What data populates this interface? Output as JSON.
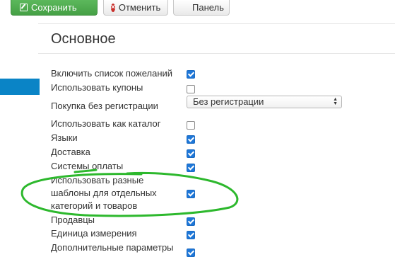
{
  "toolbar": {
    "save_label": "Сохранить",
    "cancel_label": "Отменить",
    "panel_label": "Панель"
  },
  "section": {
    "title": "Основное"
  },
  "settings": [
    {
      "label": "Включить список пожеланий",
      "checked": true
    },
    {
      "label": "Использовать купоны",
      "checked": false
    },
    {
      "label": "Покупка без регистрации",
      "type": "select",
      "value": "Без регистрации"
    },
    {
      "label": "Использовать как каталог",
      "checked": false
    },
    {
      "label": "Языки",
      "checked": true
    },
    {
      "label": "Доставка",
      "checked": true
    },
    {
      "label": "Системы оплаты",
      "checked": true
    },
    {
      "label_lines": [
        "Использовать разные",
        "шаблоны для отдельных",
        "категорий и товаров"
      ],
      "checked": true
    },
    {
      "label": "Продавцы",
      "checked": true
    },
    {
      "label": "Единица измерения",
      "checked": true
    },
    {
      "label": "Дополнительные параметры",
      "checked": true
    }
  ],
  "colors": {
    "save_button": "#5cb85c",
    "checkbox_checked": "#1e77d8",
    "side_tab": "#0a84c6",
    "annotation": "#2db82d"
  }
}
